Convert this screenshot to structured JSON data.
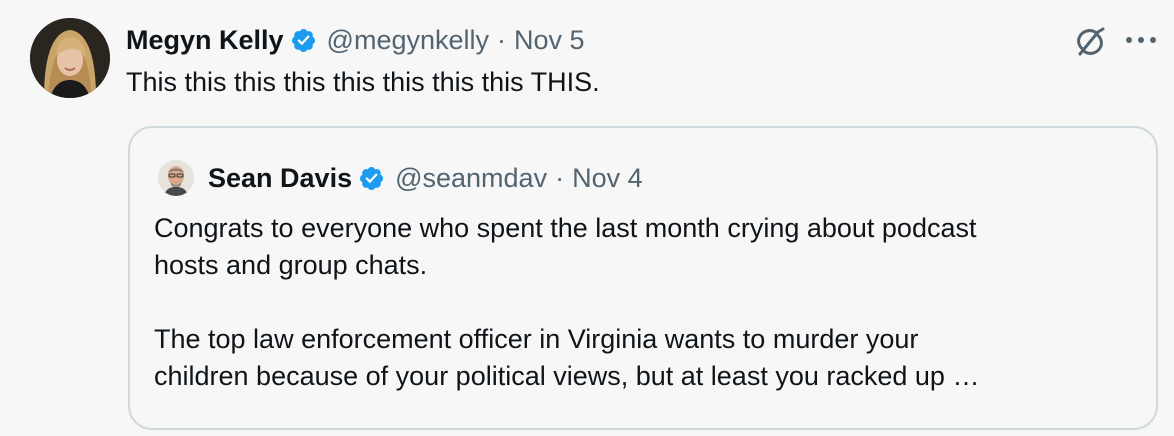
{
  "tweet": {
    "author_name": "Megyn Kelly",
    "handle": "@megynkelly",
    "separator": "·",
    "date": "Nov 5",
    "text": "This this this this this this this this THIS.",
    "verified_badge_icon": "verified-badge-icon",
    "actions": {
      "grok_icon": "grok-icon",
      "more_icon": "more-options-icon"
    }
  },
  "quoted": {
    "author_name": "Sean Davis",
    "handle": "@seanmdav",
    "separator": "·",
    "date": "Nov 4",
    "verified_badge_icon": "verified-badge-icon",
    "paragraph1_line1": "Congrats to everyone who spent the last month crying about podcast",
    "paragraph1_line2": "hosts and group chats.",
    "paragraph2_line1": "The top law enforcement officer in Virginia wants to murder your",
    "paragraph2_line2": "children because of your political views, but at least you racked up …"
  },
  "colors": {
    "background": "#f7f7f7",
    "text": "#0f1419",
    "secondary": "#536471",
    "verified": "#1d9bf0",
    "border": "#cfd9de"
  }
}
